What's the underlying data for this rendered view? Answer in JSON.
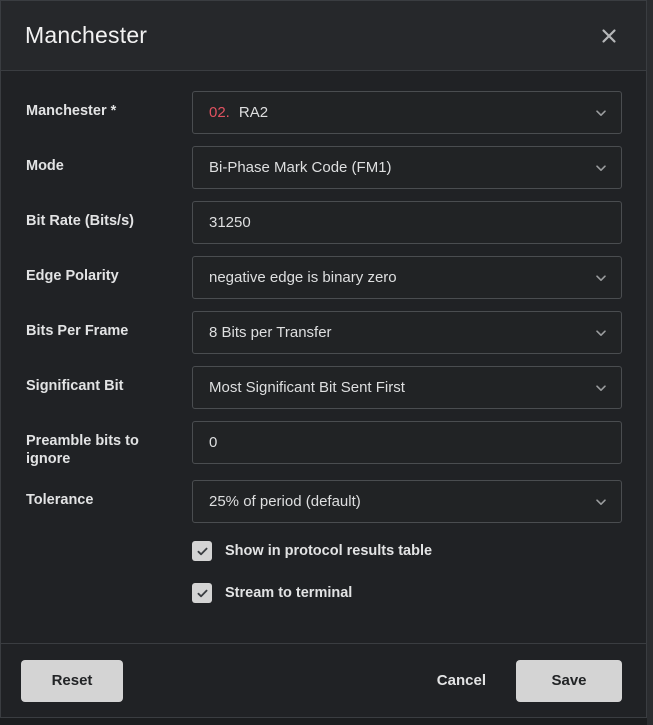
{
  "dialog": {
    "title": "Manchester",
    "close_icon": "close-icon"
  },
  "form": {
    "fields": [
      {
        "label": "Manchester *",
        "type": "select",
        "prefix": "02.",
        "value": "RA2",
        "name": "manchester-channel"
      },
      {
        "label": "Mode",
        "type": "select",
        "prefix": "",
        "value": "Bi-Phase Mark Code (FM1)",
        "name": "mode"
      },
      {
        "label": "Bit Rate (Bits/s)",
        "type": "input",
        "prefix": "",
        "value": "31250",
        "name": "bit-rate"
      },
      {
        "label": "Edge Polarity",
        "type": "select",
        "prefix": "",
        "value": "negative edge is binary zero",
        "name": "edge-polarity"
      },
      {
        "label": "Bits Per Frame",
        "type": "select",
        "prefix": "",
        "value": "8 Bits per Transfer",
        "name": "bits-per-frame"
      },
      {
        "label": "Significant Bit",
        "type": "select",
        "prefix": "",
        "value": "Most Significant Bit Sent First",
        "name": "significant-bit"
      },
      {
        "label": "Preamble bits to ignore",
        "type": "input",
        "prefix": "",
        "value": "0",
        "name": "preamble-bits-to-ignore"
      },
      {
        "label": "Tolerance",
        "type": "select",
        "prefix": "",
        "value": "25% of period (default)",
        "name": "tolerance"
      }
    ],
    "checkboxes": [
      {
        "label": "Show in protocol results table",
        "checked": true,
        "name": "show-in-protocol-results-table"
      },
      {
        "label": "Stream to terminal",
        "checked": true,
        "name": "stream-to-terminal"
      }
    ]
  },
  "footer": {
    "reset_label": "Reset",
    "cancel_label": "Cancel",
    "save_label": "Save"
  },
  "colors": {
    "accent_required": "#e05260",
    "button_solid": "#d4d4d4",
    "dialog_bg": "#202225",
    "header_bg": "#26282b",
    "field_border": "#4a4d50"
  }
}
